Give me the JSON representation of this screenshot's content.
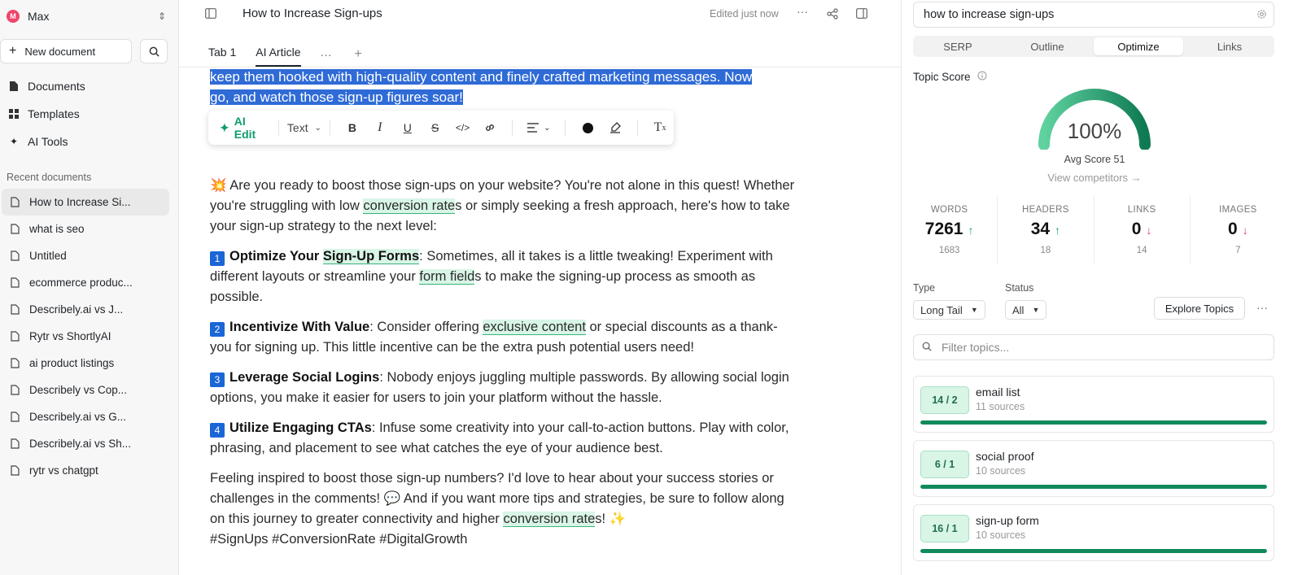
{
  "sidebar": {
    "workspace": {
      "initial": "M",
      "name": "Max"
    },
    "new_document": "New document",
    "nav": [
      {
        "label": "Documents",
        "icon": "file-icon"
      },
      {
        "label": "Templates",
        "icon": "grid-icon"
      },
      {
        "label": "AI Tools",
        "icon": "sparkle-icon"
      }
    ],
    "recent_heading": "Recent documents",
    "recent": [
      "How to Increase Si...",
      "what is seo",
      "Untitled",
      "ecommerce produc...",
      "Describely.ai vs J...",
      "Rytr vs ShortlyAI",
      "ai product listings",
      "Describely vs Cop...",
      "Describely.ai vs G...",
      "Describely.ai vs Sh...",
      "rytr vs chatgpt"
    ]
  },
  "header": {
    "title": "How to Increase Sign-ups",
    "edited": "Edited just now",
    "tabs": [
      "Tab 1",
      "AI Article"
    ]
  },
  "editor": {
    "selected_line1": "keep them hooked with high-quality content and finely crafted marketing messages. Now",
    "selected_line2": "go, and watch those sign-up figures soar!",
    "toolbar": {
      "ai_edit": "AI Edit",
      "text_style": "Text"
    },
    "intro": {
      "emoji": "💥",
      "t1": "Are you ready to boost those sign-ups on your website? You're not alone in this quest! Whether you're struggling with low ",
      "hl1": "conversion rate",
      "t2": "s or simply seeking a fresh approach, here's how to take your sign-up strategy to the next level:"
    },
    "item1": {
      "num": "1",
      "title_pre": "Optimize Your ",
      "title_hl": "Sign-Up Forms",
      "t1": ": Sometimes, all it takes is a little tweaking! Experiment with different layouts or streamline your ",
      "hl": "form field",
      "t2": "s to make the signing-up process as smooth as possible."
    },
    "item2": {
      "num": "2",
      "title": "Incentivize With Value",
      "t1": ": Consider offering ",
      "hl": "exclusive content",
      "t2": " or special discounts as a thank-you for signing up. This little incentive can be the extra push potential users need!"
    },
    "item3": {
      "num": "3",
      "title": "Leverage Social Logins",
      "t1": ": Nobody enjoys juggling multiple passwords. By allowing social login options, you make it easier for users to join your platform without the hassle."
    },
    "item4": {
      "num": "4",
      "title": "Utilize Engaging CTAs",
      "t1": ": Infuse some creativity into your call-to-action buttons. Play with color, phrasing, and placement to see what catches the eye of your audience best."
    },
    "outro": {
      "t1": "Feeling inspired to boost those sign-up numbers? I'd love to hear about your success stories or challenges in the comments! ",
      "emoji1": "💬",
      "t2": " And if you want more tips and strategies, be sure to follow along on this journey to greater connectivity and higher ",
      "hl": "conversion rate",
      "t3": "s! ",
      "emoji2": "✨",
      "tags": "#SignUps #ConversionRate #DigitalGrowth"
    }
  },
  "panel": {
    "query": "how to increase sign-ups",
    "tabs": [
      "SERP",
      "Outline",
      "Optimize",
      "Links"
    ],
    "active_tab": "Optimize",
    "topic_score_label": "Topic Score",
    "score": "100%",
    "score_fraction": 1.0,
    "avg_score": "Avg Score 51",
    "view_competitors": "View competitors →",
    "stats": [
      {
        "key": "WORDS",
        "value": "7261",
        "dir": "up",
        "sub": "1683"
      },
      {
        "key": "HEADERS",
        "value": "34",
        "dir": "up",
        "sub": "18"
      },
      {
        "key": "LINKS",
        "value": "0",
        "dir": "down",
        "sub": "14"
      },
      {
        "key": "IMAGES",
        "value": "0",
        "dir": "down",
        "sub": "7"
      }
    ],
    "filters": {
      "type_label": "Type",
      "type_value": "Long Tail",
      "status_label": "Status",
      "status_value": "All",
      "explore": "Explore Topics",
      "filter_placeholder": "Filter topics..."
    },
    "topics": [
      {
        "badge": "14 / 2",
        "name": "email list",
        "sources": "11 sources",
        "progress": 1.0
      },
      {
        "badge": "6 / 1",
        "name": "social proof",
        "sources": "10 sources",
        "progress": 1.0
      },
      {
        "badge": "16 / 1",
        "name": "sign-up form",
        "sources": "10 sources",
        "progress": 1.0
      }
    ],
    "colors": {
      "accent": "#108a5a",
      "up": "#1aa36a",
      "down": "#e0424f",
      "selection": "#2f6bd6"
    }
  }
}
